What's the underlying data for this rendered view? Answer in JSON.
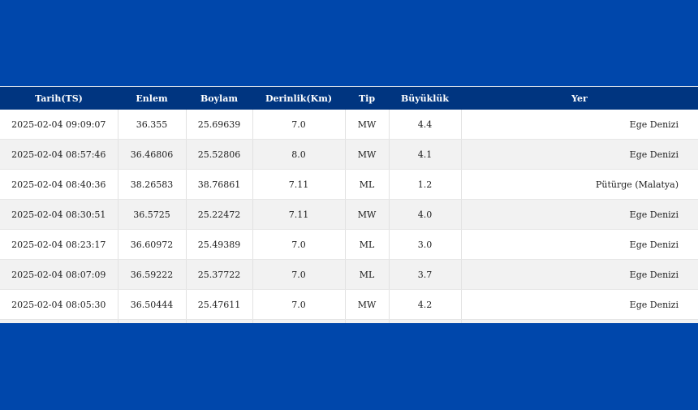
{
  "table": {
    "headers": [
      "Tarih(TS)",
      "Enlem",
      "Boylam",
      "Derinlik(Km)",
      "Tip",
      "Büyüklük",
      "Yer"
    ],
    "rows": [
      [
        "2025-02-04 09:09:07",
        "36.355",
        "25.69639",
        "7.0",
        "MW",
        "4.4",
        "Ege Denizi"
      ],
      [
        "2025-02-04 08:57:46",
        "36.46806",
        "25.52806",
        "8.0",
        "MW",
        "4.1",
        "Ege Denizi"
      ],
      [
        "2025-02-04 08:40:36",
        "38.26583",
        "38.76861",
        "7.11",
        "ML",
        "1.2",
        "Pütürge (Malatya)"
      ],
      [
        "2025-02-04 08:30:51",
        "36.5725",
        "25.22472",
        "7.11",
        "MW",
        "4.0",
        "Ege Denizi"
      ],
      [
        "2025-02-04 08:23:17",
        "36.60972",
        "25.49389",
        "7.0",
        "ML",
        "3.0",
        "Ege Denizi"
      ],
      [
        "2025-02-04 08:07:09",
        "36.59222",
        "25.37722",
        "7.0",
        "ML",
        "3.7",
        "Ege Denizi"
      ],
      [
        "2025-02-04 08:05:30",
        "36.50444",
        "25.47611",
        "7.0",
        "MW",
        "4.2",
        "Ege Denizi"
      ]
    ]
  }
}
